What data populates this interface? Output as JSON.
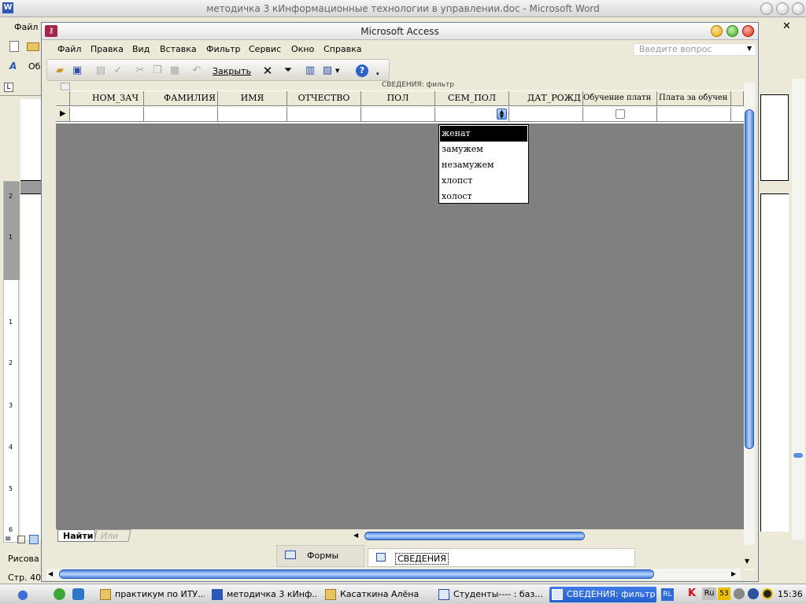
{
  "word": {
    "title": "методичка 3 кИнформационные технологии в управлении.doc - Microsoft Word",
    "menu_first": "Файл",
    "tb_label": "Об",
    "status_page": "Стр. 40",
    "draw_label": "Рисова",
    "ruler_marks": [
      "2",
      "1",
      "1",
      "2",
      "3",
      "4",
      "5",
      "6"
    ]
  },
  "access": {
    "title": "Microsoft Access",
    "menu": [
      "Файл",
      "Правка",
      "Вид",
      "Вставка",
      "Фильтр",
      "Сервис",
      "Окно",
      "Справка"
    ],
    "ask_placeholder": "Введите вопрос",
    "toolbar_close": "Закрыть",
    "sheet_caption": "СВЕДЕНИЯ: фильтр",
    "columns": [
      "НОМ_ЗАЧ",
      "ФАМИЛИЯ",
      "ИМЯ",
      "ОТЧЕСТВО",
      "ПОЛ",
      "СЕМ_ПОЛ",
      "ДАТ_РОЖД",
      "Обучение платн",
      "Плата за обучен"
    ],
    "dropdown_options": [
      "женат",
      "замужем",
      "незамужем",
      "хлопст",
      "холост"
    ],
    "selected_option": "женат",
    "filter_tabs": [
      "Найти",
      "Или"
    ],
    "bottom_tabs": [
      "Формы",
      "СВЕДЕНИЯ"
    ]
  },
  "taskbar": {
    "items": [
      "практикум по ИТУ...",
      "методичка 3 кИнф...",
      "Касаткина Алёна",
      "Студенты---- : баз...",
      "СВЕДЕНИЯ: фильтр"
    ],
    "active_index": 4,
    "lang": "RL",
    "tray_lang": "Ru",
    "tray_num": "53",
    "clock": "15:36"
  },
  "colors": {
    "datasheet_bg": "#808080",
    "selected_bg": "#000000",
    "task_active": "#2f6bd8",
    "scroll_thumb": "#4a7fd8"
  }
}
